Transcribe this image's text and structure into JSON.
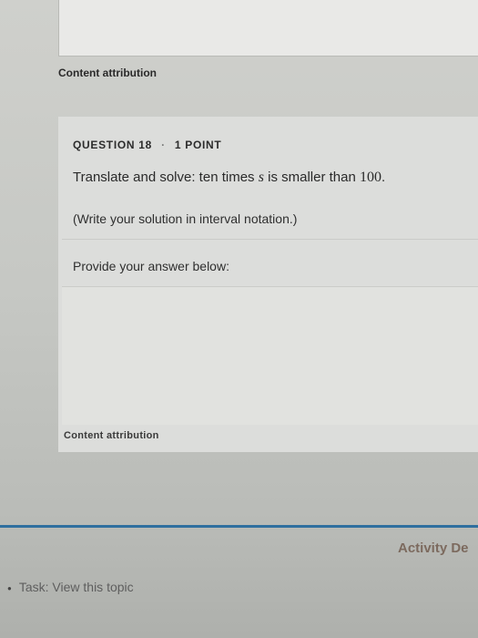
{
  "content_attribution_top": "Content attribution",
  "question": {
    "number_label": "QUESTION 18",
    "separator": "·",
    "points_label": "1 POINT",
    "prompt_prefix": "Translate and solve: ten times ",
    "variable": "s",
    "prompt_mid": " is smaller than ",
    "number": "100",
    "prompt_end": ".",
    "instruction": "(Write your solution in interval notation.)",
    "answer_label": "Provide your answer below:",
    "answer_value": "",
    "content_attribution": "Content attribution"
  },
  "footer": {
    "activity_link": "Activity De",
    "task_text": "Task: View this topic"
  }
}
